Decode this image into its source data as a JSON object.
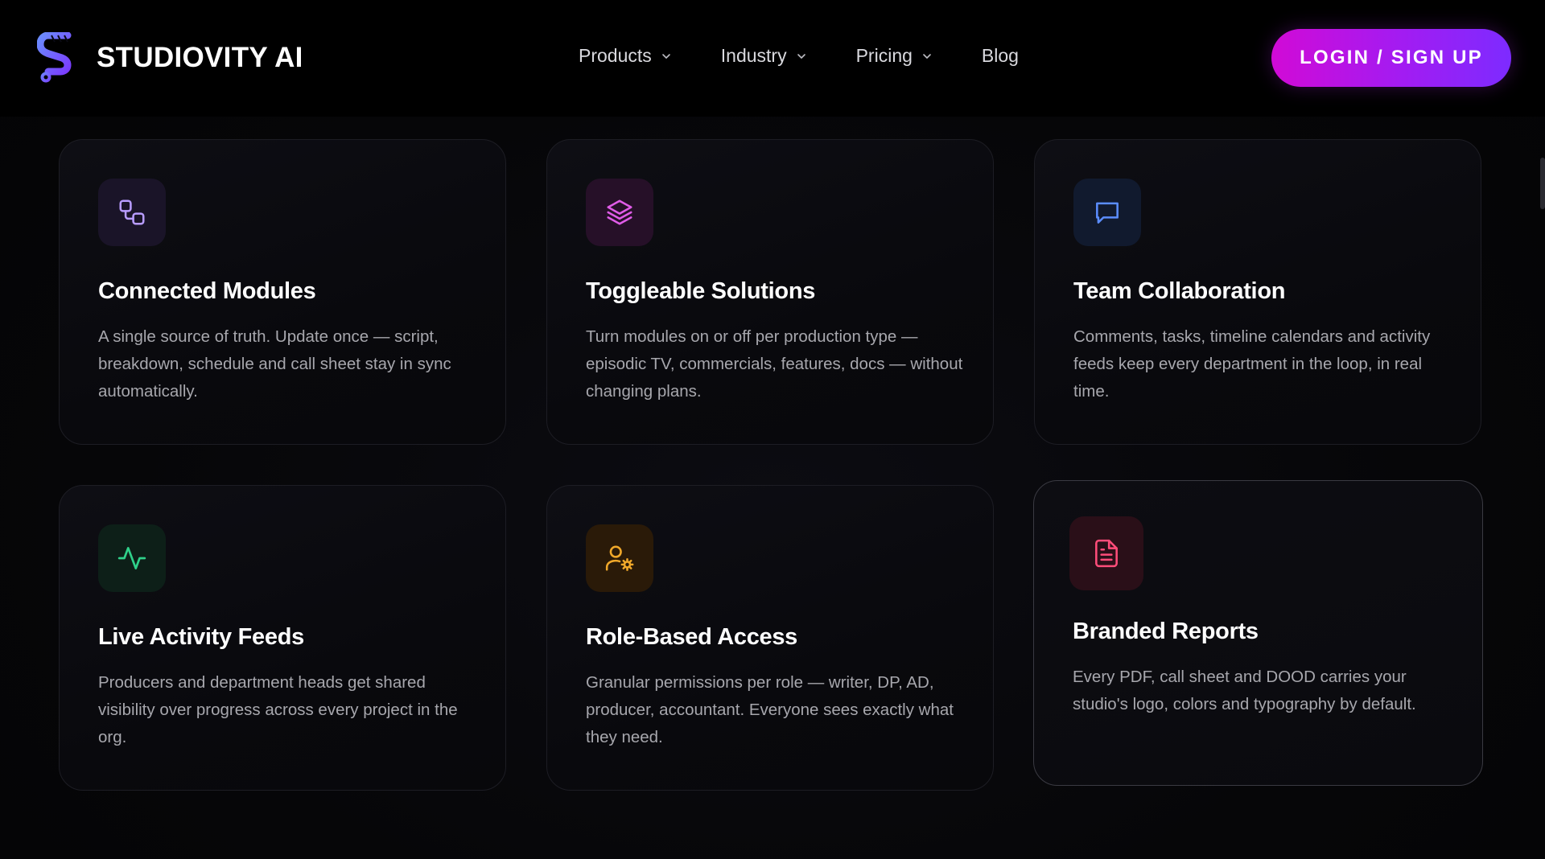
{
  "header": {
    "brand_name": "STUDIOVITY AI",
    "nav": {
      "products": "Products",
      "industry": "Industry",
      "pricing": "Pricing",
      "blog": "Blog"
    },
    "login_label": "LOGIN / SIGN UP"
  },
  "colors": {
    "accent_gradient_start": "#d10ad6",
    "accent_gradient_end": "#7d2bff",
    "background": "#050507"
  },
  "features": [
    {
      "icon": "connected-nodes-icon",
      "title": "Connected Modules",
      "description": "A single source of truth. Update once — script, breakdown, schedule and call sheet stay in sync automatically."
    },
    {
      "icon": "layers-icon",
      "title": "Toggleable Solutions",
      "description": "Turn modules on or off per production type — episodic TV, commercials, features, docs — without changing plans."
    },
    {
      "icon": "chat-bubble-icon",
      "title": "Team Collaboration",
      "description": "Comments, tasks, timeline calendars and activity feeds keep every department in the loop, in real time."
    },
    {
      "icon": "activity-pulse-icon",
      "title": "Live Activity Feeds",
      "description": "Producers and department heads get shared visibility over progress across every project in the org."
    },
    {
      "icon": "user-cog-icon",
      "title": "Role-Based Access",
      "description": "Granular permissions per role — writer, DP, AD, producer, accountant. Everyone sees exactly what they need."
    },
    {
      "icon": "file-text-icon",
      "title": "Branded Reports",
      "description": "Every PDF, call sheet and DOOD carries your studio's logo, colors and typography by default."
    }
  ]
}
